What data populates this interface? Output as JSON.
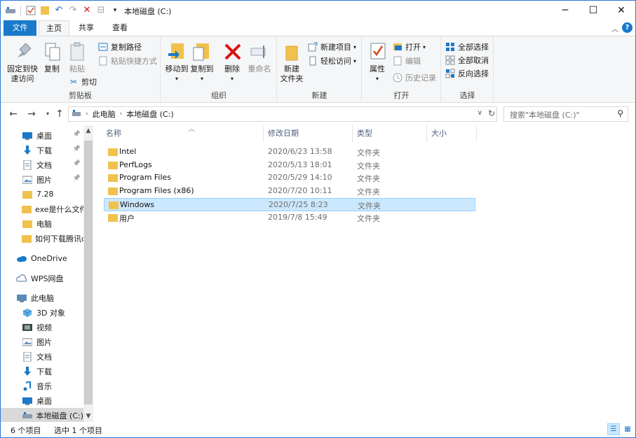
{
  "window": {
    "title": "本地磁盘 (C:)",
    "buttons": {
      "minimize": "─",
      "maximize": "☐",
      "close": "✕"
    }
  },
  "tabs": {
    "file": "文件",
    "home": "主页",
    "share": "共享",
    "view": "查看",
    "help": "?"
  },
  "ribbon": {
    "clipboard": {
      "label": "剪贴板",
      "pin": [
        "固定到快",
        "速访问"
      ],
      "copy": "复制",
      "paste": "粘贴",
      "copy_path": "复制路径",
      "paste_shortcut": "粘贴快捷方式",
      "cut": "剪切"
    },
    "organize": {
      "label": "组织",
      "move_to": "移动到",
      "copy_to": "复制到",
      "delete": "删除",
      "rename": "重命名"
    },
    "new": {
      "label": "新建",
      "new_folder": [
        "新建",
        "文件夹"
      ],
      "new_item": "新建项目",
      "easy_access": "轻松访问"
    },
    "open": {
      "label": "打开",
      "properties": "属性",
      "open": "打开",
      "edit": "编辑",
      "history": "历史记录"
    },
    "select": {
      "label": "选择",
      "select_all": "全部选择",
      "select_none": "全部取消",
      "invert": "反向选择"
    }
  },
  "address": {
    "root": "此电脑",
    "current": "本地磁盘 (C:)"
  },
  "search": {
    "placeholder": "搜索\"本地磁盘 (C:)\""
  },
  "nav": [
    {
      "label": "桌面",
      "icon": "desktop-icon",
      "pinned": true
    },
    {
      "label": "下载",
      "icon": "download-icon",
      "pinned": true
    },
    {
      "label": "文档",
      "icon": "document-icon",
      "pinned": true
    },
    {
      "label": "图片",
      "icon": "picture-icon",
      "pinned": true
    },
    {
      "label": "7.28",
      "icon": "folder-icon"
    },
    {
      "label": "exe是什么文件",
      "icon": "folder-icon"
    },
    {
      "label": "电脑",
      "icon": "folder-icon"
    },
    {
      "label": "如何下载腾讯d",
      "icon": "folder-icon"
    },
    {
      "label": "OneDrive",
      "icon": "onedrive-icon"
    },
    {
      "label": "WPS网盘",
      "icon": "wps-cloud-icon"
    },
    {
      "label": "此电脑",
      "icon": "this-pc-icon"
    },
    {
      "label": "3D 对象",
      "icon": "3d-objects-icon"
    },
    {
      "label": "视频",
      "icon": "video-icon"
    },
    {
      "label": "图片",
      "icon": "picture-icon"
    },
    {
      "label": "文档",
      "icon": "document-icon"
    },
    {
      "label": "下载",
      "icon": "download-icon"
    },
    {
      "label": "音乐",
      "icon": "music-icon"
    },
    {
      "label": "桌面",
      "icon": "desktop-icon"
    },
    {
      "label": "本地磁盘 (C:)",
      "icon": "drive-icon",
      "selected": true
    }
  ],
  "columns": {
    "name": "名称",
    "date": "修改日期",
    "type": "类型",
    "size": "大小"
  },
  "files": [
    {
      "name": "Intel",
      "date": "2020/6/23 13:58",
      "type": "文件夹"
    },
    {
      "name": "PerfLogs",
      "date": "2020/5/13 18:01",
      "type": "文件夹"
    },
    {
      "name": "Program Files",
      "date": "2020/5/29 14:10",
      "type": "文件夹"
    },
    {
      "name": "Program Files (x86)",
      "date": "2020/7/20 10:11",
      "type": "文件夹"
    },
    {
      "name": "Windows",
      "date": "2020/7/25 8:23",
      "type": "文件夹",
      "selected": true
    },
    {
      "name": "用户",
      "date": "2019/7/8 15:49",
      "type": "文件夹"
    }
  ],
  "status": {
    "count": "6 个项目",
    "selected": "选中 1 个项目"
  },
  "colors": {
    "accent": "#1979ca",
    "selection": "#cce8ff",
    "folder": "#f0c24d"
  }
}
